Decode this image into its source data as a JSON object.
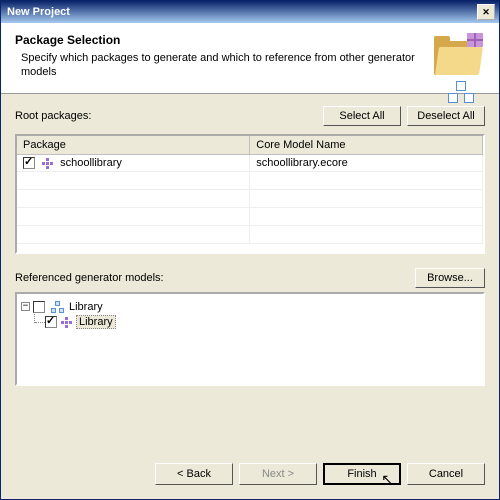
{
  "window": {
    "title": "New Project"
  },
  "header": {
    "title": "Package Selection",
    "description": "Specify which packages to generate and which to reference from other generator models"
  },
  "rootPackages": {
    "label": "Root packages:",
    "selectAll": "Select All",
    "deselectAll": "Deselect All",
    "columns": {
      "package": "Package",
      "model": "Core Model Name"
    },
    "rows": [
      {
        "checked": true,
        "name": "schoollibrary",
        "model": "schoollibrary.ecore"
      }
    ]
  },
  "referenced": {
    "label": "Referenced generator models:",
    "browse": "Browse...",
    "tree": {
      "root": {
        "checked": false,
        "label": "Library"
      },
      "child": {
        "checked": true,
        "label": "Library"
      }
    }
  },
  "buttons": {
    "back": "< Back",
    "next": "Next >",
    "finish": "Finish",
    "cancel": "Cancel"
  }
}
